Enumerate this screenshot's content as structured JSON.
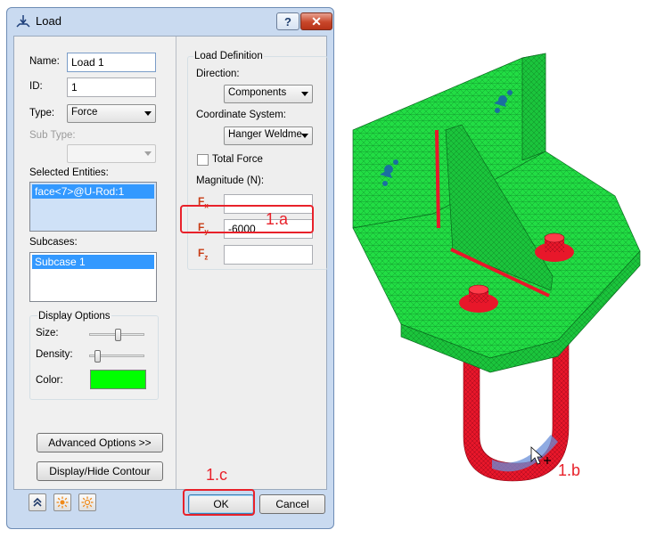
{
  "window": {
    "title": "Load",
    "help_label": "?",
    "close_label": "✕"
  },
  "left": {
    "name_label": "Name:",
    "name_value": "Load 1",
    "id_label": "ID:",
    "id_value": "1",
    "type_label": "Type:",
    "type_value": "Force",
    "subtype_label": "Sub Type:",
    "subtype_value": "",
    "selected_entities_label": "Selected Entities:",
    "selected_entities": [
      "face<7>@U-Rod:1"
    ],
    "subcases_label": "Subcases:",
    "subcases": [
      "Subcase 1"
    ],
    "display_options": {
      "title": "Display Options",
      "size_label": "Size:",
      "size_level": 0.55,
      "density_label": "Density:",
      "density_level": 0.12,
      "color_label": "Color:",
      "color": "#00ff00"
    },
    "advanced_button": "Advanced Options >>",
    "contour_button": "Display/Hide Contour"
  },
  "right": {
    "group_title": "Load Definition",
    "direction_label": "Direction:",
    "direction_value": "Components",
    "coord_label": "Coordinate System:",
    "coord_value": "Hanger Weldme",
    "total_force_label": "Total Force",
    "total_force_checked": false,
    "magnitude_label": "Magnitude (N):",
    "fx_label": "F",
    "fx_sub": "x",
    "fx_value": "",
    "fy_label": "F",
    "fy_sub": "y",
    "fy_value": "-6000",
    "fz_label": "F",
    "fz_sub": "z",
    "fz_value": ""
  },
  "footer": {
    "ok_label": "OK",
    "cancel_label": "Cancel"
  },
  "annotations": {
    "a": "1.a",
    "b": "1.b",
    "c": "1.c"
  },
  "colors": {
    "callout_red": "#e8212a",
    "mesh_green": "#22dd44",
    "mesh_red": "#e8172a",
    "accent_blue": "#3399ff"
  },
  "icons": [
    "load-icon",
    "expand-icon",
    "sun-icon",
    "sun-outline-icon",
    "cursor-icon"
  ]
}
